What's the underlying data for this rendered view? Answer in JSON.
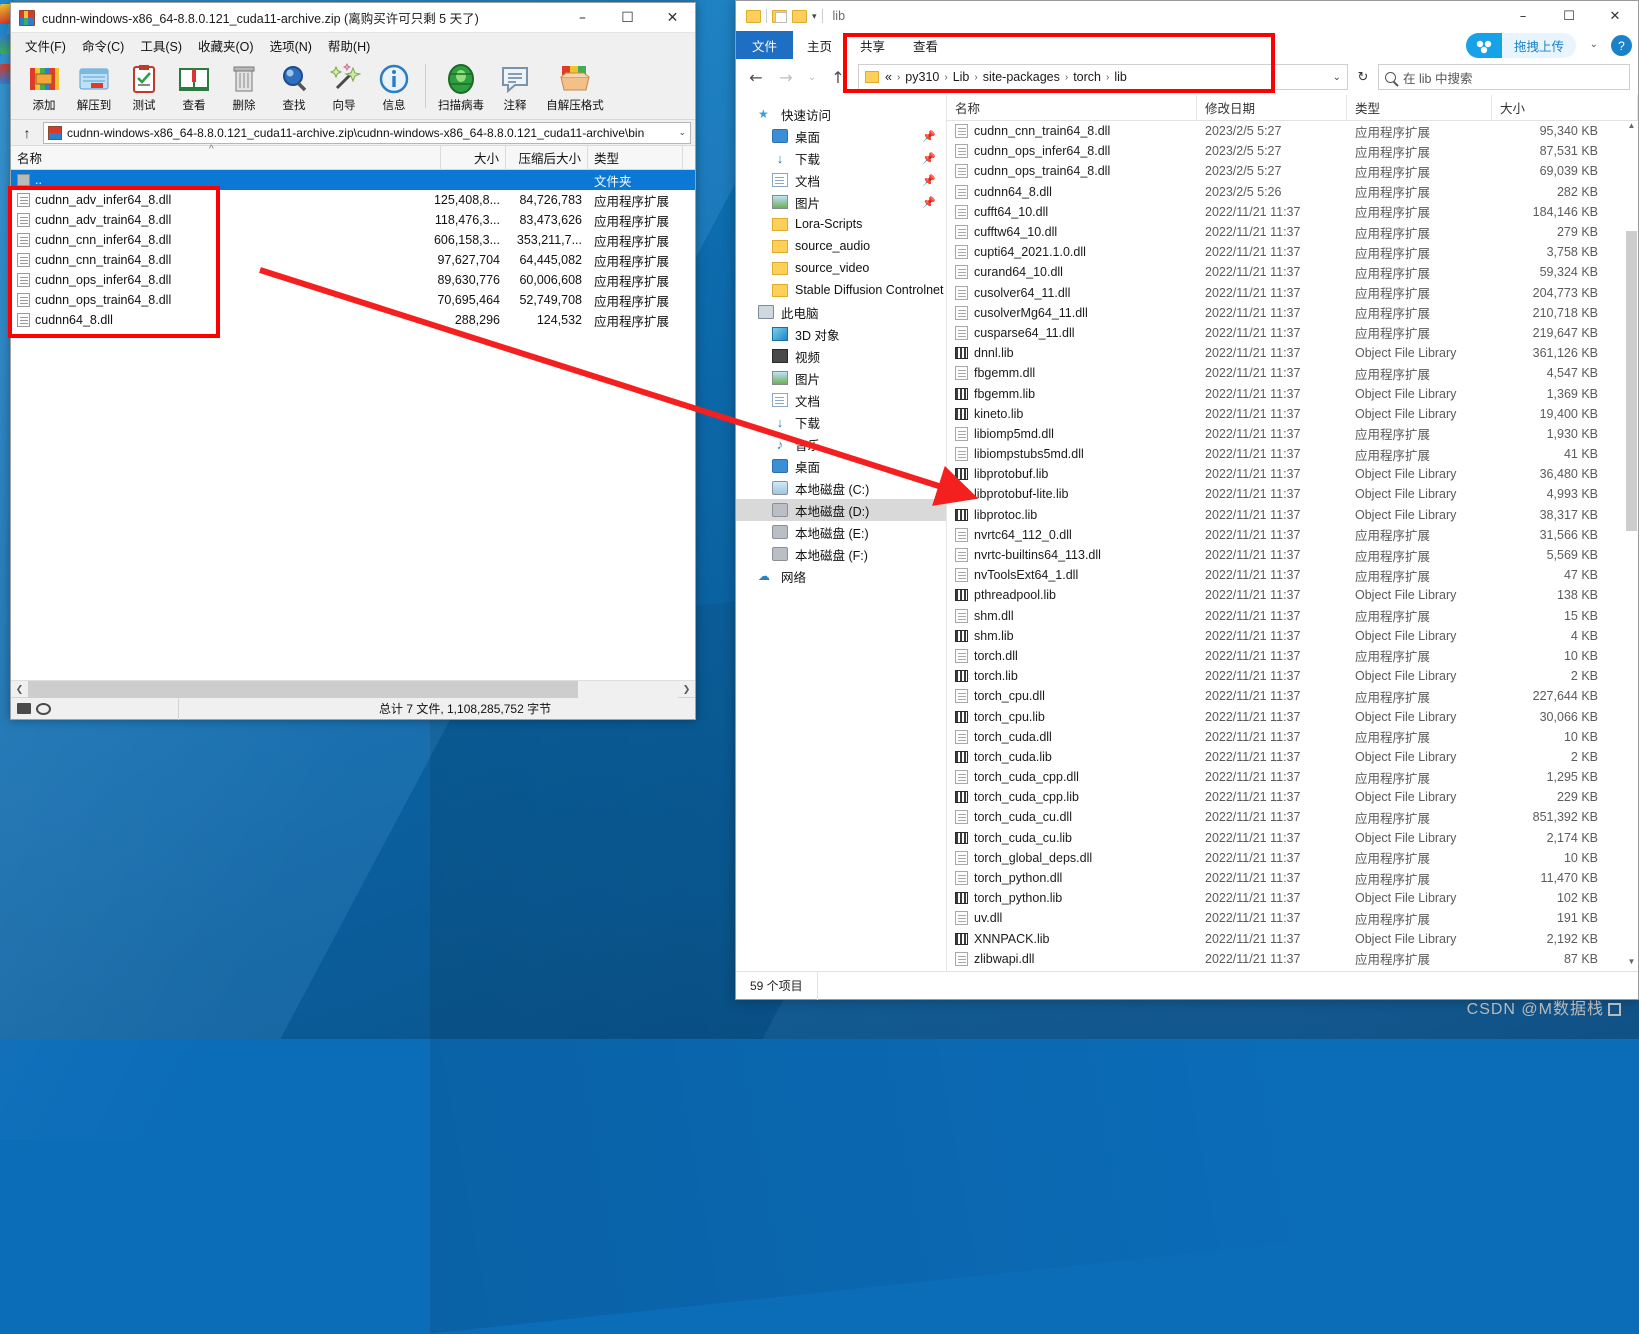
{
  "winrar": {
    "title": "cudnn-windows-x86_64-8.8.0.121_cuda11-archive.zip (离购买许可只剩 5 天了)",
    "window_controls": {
      "minimize": "–",
      "maximize": "☐",
      "close": "✕"
    },
    "menu": [
      "文件(F)",
      "命令(C)",
      "工具(S)",
      "收藏夹(O)",
      "选项(N)",
      "帮助(H)"
    ],
    "toolbar": [
      {
        "label": "添加",
        "icon": "add-archive-icon"
      },
      {
        "label": "解压到",
        "icon": "extract-to-icon"
      },
      {
        "label": "测试",
        "icon": "test-icon"
      },
      {
        "label": "查看",
        "icon": "view-icon"
      },
      {
        "label": "删除",
        "icon": "delete-icon"
      },
      {
        "label": "查找",
        "icon": "find-icon"
      },
      {
        "label": "向导",
        "icon": "wizard-icon"
      },
      {
        "label": "信息",
        "icon": "info-icon"
      },
      {
        "label": "扫描病毒",
        "icon": "virus-scan-icon"
      },
      {
        "label": "注释",
        "icon": "comment-icon"
      },
      {
        "label": "自解压格式",
        "icon": "sfx-icon"
      }
    ],
    "path": "cudnn-windows-x86_64-8.8.0.121_cuda11-archive.zip\\cudnn-windows-x86_64-8.8.0.121_cuda11-archive\\bin",
    "columns": [
      "名称",
      "大小",
      "压缩后大小",
      "类型"
    ],
    "rows": [
      {
        "name": "..",
        "size": "",
        "packed": "",
        "type": "文件夹",
        "selected": true,
        "icon": "folder-up-icon"
      },
      {
        "name": "cudnn_adv_infer64_8.dll",
        "size": "125,408,8...",
        "packed": "84,726,783",
        "type": "应用程序扩展",
        "icon": "dll-icon"
      },
      {
        "name": "cudnn_adv_train64_8.dll",
        "size": "118,476,3...",
        "packed": "83,473,626",
        "type": "应用程序扩展",
        "icon": "dll-icon"
      },
      {
        "name": "cudnn_cnn_infer64_8.dll",
        "size": "606,158,3...",
        "packed": "353,211,7...",
        "type": "应用程序扩展",
        "icon": "dll-icon"
      },
      {
        "name": "cudnn_cnn_train64_8.dll",
        "size": "97,627,704",
        "packed": "64,445,082",
        "type": "应用程序扩展",
        "icon": "dll-icon"
      },
      {
        "name": "cudnn_ops_infer64_8.dll",
        "size": "89,630,776",
        "packed": "60,006,608",
        "type": "应用程序扩展",
        "icon": "dll-icon"
      },
      {
        "name": "cudnn_ops_train64_8.dll",
        "size": "70,695,464",
        "packed": "52,749,708",
        "type": "应用程序扩展",
        "icon": "dll-icon"
      },
      {
        "name": "cudnn64_8.dll",
        "size": "288,296",
        "packed": "124,532",
        "type": "应用程序扩展",
        "icon": "dll-icon"
      }
    ],
    "status": "总计 7 文件, 1,108,285,752 字节"
  },
  "explorer": {
    "quick_access_title": "lib",
    "window_controls": {
      "minimize": "–",
      "maximize": "☐",
      "close": "✕"
    },
    "tabs": [
      {
        "label": "文件",
        "active": true
      },
      {
        "label": "主页",
        "active": false
      },
      {
        "label": "共享",
        "active": false
      },
      {
        "label": "查看",
        "active": false
      }
    ],
    "upload_button": "拖拽上传",
    "breadcrumb": {
      "prefix": "«",
      "parts": [
        "py310",
        "Lib",
        "site-packages",
        "torch",
        "lib"
      ]
    },
    "search_placeholder": "在 lib 中搜索",
    "nav": [
      {
        "label": "快速访问",
        "icon": "star-icon",
        "level": 1,
        "pin": false
      },
      {
        "label": "桌面",
        "icon": "desktop-icon",
        "level": 2,
        "pin": true
      },
      {
        "label": "下载",
        "icon": "downloads-icon",
        "level": 2,
        "pin": true
      },
      {
        "label": "文档",
        "icon": "documents-icon",
        "level": 2,
        "pin": true
      },
      {
        "label": "图片",
        "icon": "pictures-icon",
        "level": 2,
        "pin": true
      },
      {
        "label": "Lora-Scripts",
        "icon": "folder-icon",
        "level": 2,
        "pin": false
      },
      {
        "label": "source_audio",
        "icon": "folder-icon",
        "level": 2,
        "pin": false
      },
      {
        "label": "source_video",
        "icon": "folder-icon",
        "level": 2,
        "pin": false
      },
      {
        "label": "Stable Diffusion Controlnet",
        "icon": "folder-icon",
        "level": 2,
        "pin": false
      },
      {
        "label": "此电脑",
        "icon": "this-pc-icon",
        "level": 1,
        "pin": false
      },
      {
        "label": "3D 对象",
        "icon": "3d-objects-icon",
        "level": 2,
        "pin": false
      },
      {
        "label": "视频",
        "icon": "videos-icon",
        "level": 2,
        "pin": false
      },
      {
        "label": "图片",
        "icon": "pictures-icon",
        "level": 2,
        "pin": false
      },
      {
        "label": "文档",
        "icon": "documents-icon",
        "level": 2,
        "pin": false
      },
      {
        "label": "下载",
        "icon": "downloads-icon",
        "level": 2,
        "pin": false
      },
      {
        "label": "音乐",
        "icon": "music-icon",
        "level": 2,
        "pin": false
      },
      {
        "label": "桌面",
        "icon": "desktop-icon",
        "level": 2,
        "pin": false
      },
      {
        "label": "本地磁盘 (C:)",
        "icon": "disk-system-icon",
        "level": 2,
        "pin": false
      },
      {
        "label": "本地磁盘 (D:)",
        "icon": "disk-icon",
        "level": 2,
        "pin": false,
        "selected": true
      },
      {
        "label": "本地磁盘 (E:)",
        "icon": "disk-icon",
        "level": 2,
        "pin": false
      },
      {
        "label": "本地磁盘 (F:)",
        "icon": "disk-icon",
        "level": 2,
        "pin": false
      },
      {
        "label": "网络",
        "icon": "network-icon",
        "level": 1,
        "pin": false
      }
    ],
    "columns": [
      "名称",
      "修改日期",
      "类型",
      "大小"
    ],
    "files": [
      {
        "name": "cudnn_cnn_train64_8.dll",
        "date": "2023/2/5 5:27",
        "type": "应用程序扩展",
        "size": "95,340 KB",
        "icon": "dll-icon"
      },
      {
        "name": "cudnn_ops_infer64_8.dll",
        "date": "2023/2/5 5:27",
        "type": "应用程序扩展",
        "size": "87,531 KB",
        "icon": "dll-icon"
      },
      {
        "name": "cudnn_ops_train64_8.dll",
        "date": "2023/2/5 5:27",
        "type": "应用程序扩展",
        "size": "69,039 KB",
        "icon": "dll-icon"
      },
      {
        "name": "cudnn64_8.dll",
        "date": "2023/2/5 5:26",
        "type": "应用程序扩展",
        "size": "282 KB",
        "icon": "dll-icon"
      },
      {
        "name": "cufft64_10.dll",
        "date": "2022/11/21 11:37",
        "type": "应用程序扩展",
        "size": "184,146 KB",
        "icon": "dll-icon"
      },
      {
        "name": "cufftw64_10.dll",
        "date": "2022/11/21 11:37",
        "type": "应用程序扩展",
        "size": "279 KB",
        "icon": "dll-icon"
      },
      {
        "name": "cupti64_2021.1.0.dll",
        "date": "2022/11/21 11:37",
        "type": "应用程序扩展",
        "size": "3,758 KB",
        "icon": "dll-icon"
      },
      {
        "name": "curand64_10.dll",
        "date": "2022/11/21 11:37",
        "type": "应用程序扩展",
        "size": "59,324 KB",
        "icon": "dll-icon"
      },
      {
        "name": "cusolver64_11.dll",
        "date": "2022/11/21 11:37",
        "type": "应用程序扩展",
        "size": "204,773 KB",
        "icon": "dll-icon"
      },
      {
        "name": "cusolverMg64_11.dll",
        "date": "2022/11/21 11:37",
        "type": "应用程序扩展",
        "size": "210,718 KB",
        "icon": "dll-icon"
      },
      {
        "name": "cusparse64_11.dll",
        "date": "2022/11/21 11:37",
        "type": "应用程序扩展",
        "size": "219,647 KB",
        "icon": "dll-icon"
      },
      {
        "name": "dnnl.lib",
        "date": "2022/11/21 11:37",
        "type": "Object File Library",
        "size": "361,126 KB",
        "icon": "lib-icon"
      },
      {
        "name": "fbgemm.dll",
        "date": "2022/11/21 11:37",
        "type": "应用程序扩展",
        "size": "4,547 KB",
        "icon": "dll-icon"
      },
      {
        "name": "fbgemm.lib",
        "date": "2022/11/21 11:37",
        "type": "Object File Library",
        "size": "1,369 KB",
        "icon": "lib-icon"
      },
      {
        "name": "kineto.lib",
        "date": "2022/11/21 11:37",
        "type": "Object File Library",
        "size": "19,400 KB",
        "icon": "lib-icon"
      },
      {
        "name": "libiomp5md.dll",
        "date": "2022/11/21 11:37",
        "type": "应用程序扩展",
        "size": "1,930 KB",
        "icon": "dll-icon"
      },
      {
        "name": "libiompstubs5md.dll",
        "date": "2022/11/21 11:37",
        "type": "应用程序扩展",
        "size": "41 KB",
        "icon": "dll-icon"
      },
      {
        "name": "libprotobuf.lib",
        "date": "2022/11/21 11:37",
        "type": "Object File Library",
        "size": "36,480 KB",
        "icon": "lib-icon"
      },
      {
        "name": "libprotobuf-lite.lib",
        "date": "2022/11/21 11:37",
        "type": "Object File Library",
        "size": "4,993 KB",
        "icon": "lib-icon"
      },
      {
        "name": "libprotoc.lib",
        "date": "2022/11/21 11:37",
        "type": "Object File Library",
        "size": "38,317 KB",
        "icon": "lib-icon"
      },
      {
        "name": "nvrtc64_112_0.dll",
        "date": "2022/11/21 11:37",
        "type": "应用程序扩展",
        "size": "31,566 KB",
        "icon": "dll-icon"
      },
      {
        "name": "nvrtc-builtins64_113.dll",
        "date": "2022/11/21 11:37",
        "type": "应用程序扩展",
        "size": "5,569 KB",
        "icon": "dll-icon"
      },
      {
        "name": "nvToolsExt64_1.dll",
        "date": "2022/11/21 11:37",
        "type": "应用程序扩展",
        "size": "47 KB",
        "icon": "dll-icon"
      },
      {
        "name": "pthreadpool.lib",
        "date": "2022/11/21 11:37",
        "type": "Object File Library",
        "size": "138 KB",
        "icon": "lib-icon"
      },
      {
        "name": "shm.dll",
        "date": "2022/11/21 11:37",
        "type": "应用程序扩展",
        "size": "15 KB",
        "icon": "dll-icon"
      },
      {
        "name": "shm.lib",
        "date": "2022/11/21 11:37",
        "type": "Object File Library",
        "size": "4 KB",
        "icon": "lib-icon"
      },
      {
        "name": "torch.dll",
        "date": "2022/11/21 11:37",
        "type": "应用程序扩展",
        "size": "10 KB",
        "icon": "dll-icon"
      },
      {
        "name": "torch.lib",
        "date": "2022/11/21 11:37",
        "type": "Object File Library",
        "size": "2 KB",
        "icon": "lib-icon"
      },
      {
        "name": "torch_cpu.dll",
        "date": "2022/11/21 11:37",
        "type": "应用程序扩展",
        "size": "227,644 KB",
        "icon": "dll-icon"
      },
      {
        "name": "torch_cpu.lib",
        "date": "2022/11/21 11:37",
        "type": "Object File Library",
        "size": "30,066 KB",
        "icon": "lib-icon"
      },
      {
        "name": "torch_cuda.dll",
        "date": "2022/11/21 11:37",
        "type": "应用程序扩展",
        "size": "10 KB",
        "icon": "dll-icon"
      },
      {
        "name": "torch_cuda.lib",
        "date": "2022/11/21 11:37",
        "type": "Object File Library",
        "size": "2 KB",
        "icon": "lib-icon"
      },
      {
        "name": "torch_cuda_cpp.dll",
        "date": "2022/11/21 11:37",
        "type": "应用程序扩展",
        "size": "1,295 KB",
        "icon": "dll-icon"
      },
      {
        "name": "torch_cuda_cpp.lib",
        "date": "2022/11/21 11:37",
        "type": "Object File Library",
        "size": "229 KB",
        "icon": "lib-icon"
      },
      {
        "name": "torch_cuda_cu.dll",
        "date": "2022/11/21 11:37",
        "type": "应用程序扩展",
        "size": "851,392 KB",
        "icon": "dll-icon"
      },
      {
        "name": "torch_cuda_cu.lib",
        "date": "2022/11/21 11:37",
        "type": "Object File Library",
        "size": "2,174 KB",
        "icon": "lib-icon"
      },
      {
        "name": "torch_global_deps.dll",
        "date": "2022/11/21 11:37",
        "type": "应用程序扩展",
        "size": "10 KB",
        "icon": "dll-icon"
      },
      {
        "name": "torch_python.dll",
        "date": "2022/11/21 11:37",
        "type": "应用程序扩展",
        "size": "11,470 KB",
        "icon": "dll-icon"
      },
      {
        "name": "torch_python.lib",
        "date": "2022/11/21 11:37",
        "type": "Object File Library",
        "size": "102 KB",
        "icon": "lib-icon"
      },
      {
        "name": "uv.dll",
        "date": "2022/11/21 11:37",
        "type": "应用程序扩展",
        "size": "191 KB",
        "icon": "dll-icon"
      },
      {
        "name": "XNNPACK.lib",
        "date": "2022/11/21 11:37",
        "type": "Object File Library",
        "size": "2,192 KB",
        "icon": "lib-icon"
      },
      {
        "name": "zlibwapi.dll",
        "date": "2022/11/21 11:37",
        "type": "应用程序扩展",
        "size": "87 KB",
        "icon": "dll-icon"
      }
    ],
    "status": "59 个项目"
  },
  "annotations": {
    "highlight_color": "#ff0000",
    "arrow": "red-arrow-from-winrar-files-to-explorer-lib-folder"
  },
  "watermark": "CSDN @M数据栈"
}
